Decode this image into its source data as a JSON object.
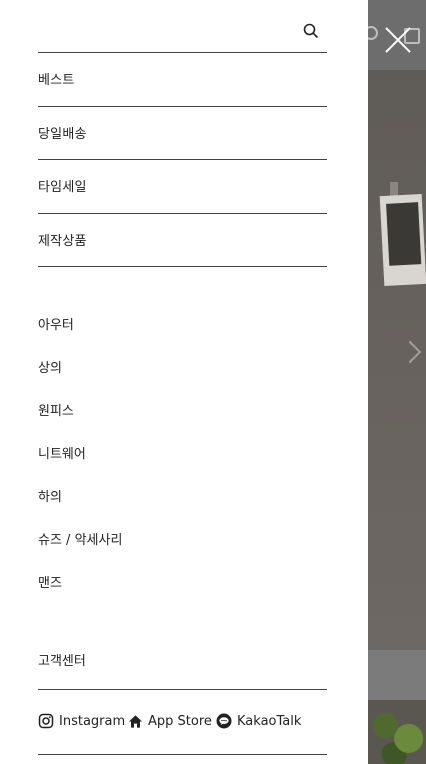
{
  "search": {
    "placeholder": ""
  },
  "main_menu": [
    {
      "label": "베스트"
    },
    {
      "label": "당일배송"
    },
    {
      "label": "타임세일"
    },
    {
      "label": "제작상품"
    }
  ],
  "sub_menu": [
    {
      "label": "아우터"
    },
    {
      "label": "상의"
    },
    {
      "label": "원피스"
    },
    {
      "label": "니트웨어"
    },
    {
      "label": "하의"
    },
    {
      "label": "슈즈 / 악세사리"
    },
    {
      "label": "맨즈"
    }
  ],
  "customer_center": {
    "label": "고객센터"
  },
  "social": {
    "instagram": {
      "label": "Instagram",
      "icon": "instagram-icon"
    },
    "app_store": {
      "label": "App Store",
      "icon": "home-icon"
    },
    "kakao": {
      "label": "KakaoTalk",
      "icon": "kakaotalk-icon"
    }
  },
  "colors": {
    "drawer_bg": "#ffffff",
    "text": "#222222",
    "divider": "#444444",
    "overlay": "#6b6b6b"
  }
}
